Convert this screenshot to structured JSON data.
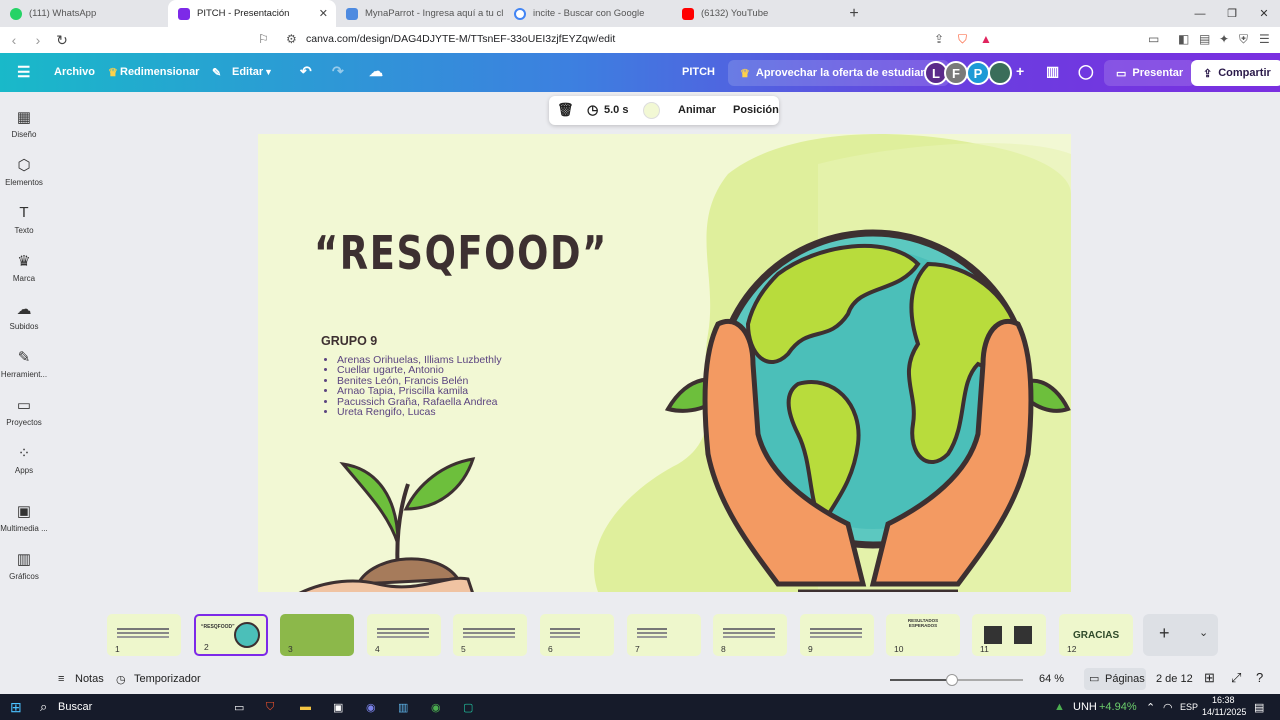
{
  "browser": {
    "tabs": [
      {
        "label": "(111) WhatsApp",
        "color": "#25d366"
      },
      {
        "label": "PITCH - Presentación",
        "color": "#7d2ae8"
      },
      {
        "label": "MynaParrot - Ingresa aquí a tu cl",
        "color": "#4d8ae0"
      },
      {
        "label": "incite - Buscar con Google",
        "color": "#4285f4"
      },
      {
        "label": "(6132) YouTube",
        "color": "#ff0000"
      }
    ],
    "url": "canva.com/design/DAG4DJYTE-M/TTsnEF-33oUEI3zjfEYZqw/edit"
  },
  "header": {
    "archivo": "Archivo",
    "redimensionar": "Redimensionar",
    "editar": "Editar",
    "title": "PITCH",
    "offer": "Aprovechar la oferta de estudiante",
    "avatars": [
      {
        "letter": "L",
        "color": "#5a2a8a"
      },
      {
        "letter": "F",
        "color": "#7a7a7a"
      },
      {
        "letter": "P",
        "color": "#1e9ad6"
      }
    ],
    "presentar": "Presentar",
    "compartir": "Compartir"
  },
  "sidebar": {
    "items": [
      {
        "label": "Diseño",
        "icon": "layout-icon",
        "glyph": "▦"
      },
      {
        "label": "Elementos",
        "icon": "shapes-icon",
        "glyph": "⬡"
      },
      {
        "label": "Texto",
        "icon": "text-icon",
        "glyph": "T"
      },
      {
        "label": "Marca",
        "icon": "brand-icon",
        "glyph": "♛"
      },
      {
        "label": "Subidos",
        "icon": "cloud-upload-icon",
        "glyph": "☁"
      },
      {
        "label": "Herramient...",
        "icon": "pen-icon",
        "glyph": "✎"
      },
      {
        "label": "Proyectos",
        "icon": "folder-icon",
        "glyph": "▭"
      },
      {
        "label": "Apps",
        "icon": "apps-icon",
        "glyph": "⁘"
      },
      {
        "label": "Multimedia ...",
        "icon": "media-icon",
        "glyph": "▣"
      },
      {
        "label": "Gráficos",
        "icon": "chart-icon",
        "glyph": "▥"
      }
    ]
  },
  "toolbar": {
    "duration": "5.0 s",
    "animar": "Animar",
    "posicion": "Posición",
    "bg_color": "#f2f8d4"
  },
  "slide": {
    "title": "“RESQFOOD”",
    "group": "GRUPO 9",
    "members": [
      "Arenas Orihuelas, Illiams Luzbethly",
      "Cuellar ugarte, Antonio",
      "Benites León, Francis Belén",
      "Arnao Tapia, Priscilla kamila",
      "Pacussich Graña, Rafaella Andrea",
      "Ureta Rengifo, Lucas"
    ]
  },
  "thumbnails": [
    {
      "num": "1",
      "bg": "#eef7cc"
    },
    {
      "num": "2",
      "bg": "#eef7cc"
    },
    {
      "num": "3",
      "bg": "#8cb84a"
    },
    {
      "num": "4",
      "bg": "#eef7cc"
    },
    {
      "num": "5",
      "bg": "#eef7cc"
    },
    {
      "num": "6",
      "bg": "#eef7cc"
    },
    {
      "num": "7",
      "bg": "#eef7cc"
    },
    {
      "num": "8",
      "bg": "#eef7cc"
    },
    {
      "num": "9",
      "bg": "#eef7cc"
    },
    {
      "num": "10",
      "bg": "#eef7cc"
    },
    {
      "num": "11",
      "bg": "#eef7cc"
    },
    {
      "num": "12",
      "bg": "#eef7cc"
    }
  ],
  "thumb_texts": {
    "t2": "“RESQFOOD”",
    "t12": "GRACIAS",
    "t10": "RESULTADOS ESPERADOS"
  },
  "footer": {
    "notas": "Notas",
    "temporizador": "Temporizador",
    "zoom": "64 %",
    "zoom_level": 0.64,
    "paginas": "Páginas",
    "pages": "2 de 12"
  },
  "taskbar": {
    "search": "Buscar",
    "stock": "UNH",
    "stock_change": "+4.94%",
    "lang": "ESP",
    "time": "16:38",
    "date": "14/11/2025"
  }
}
